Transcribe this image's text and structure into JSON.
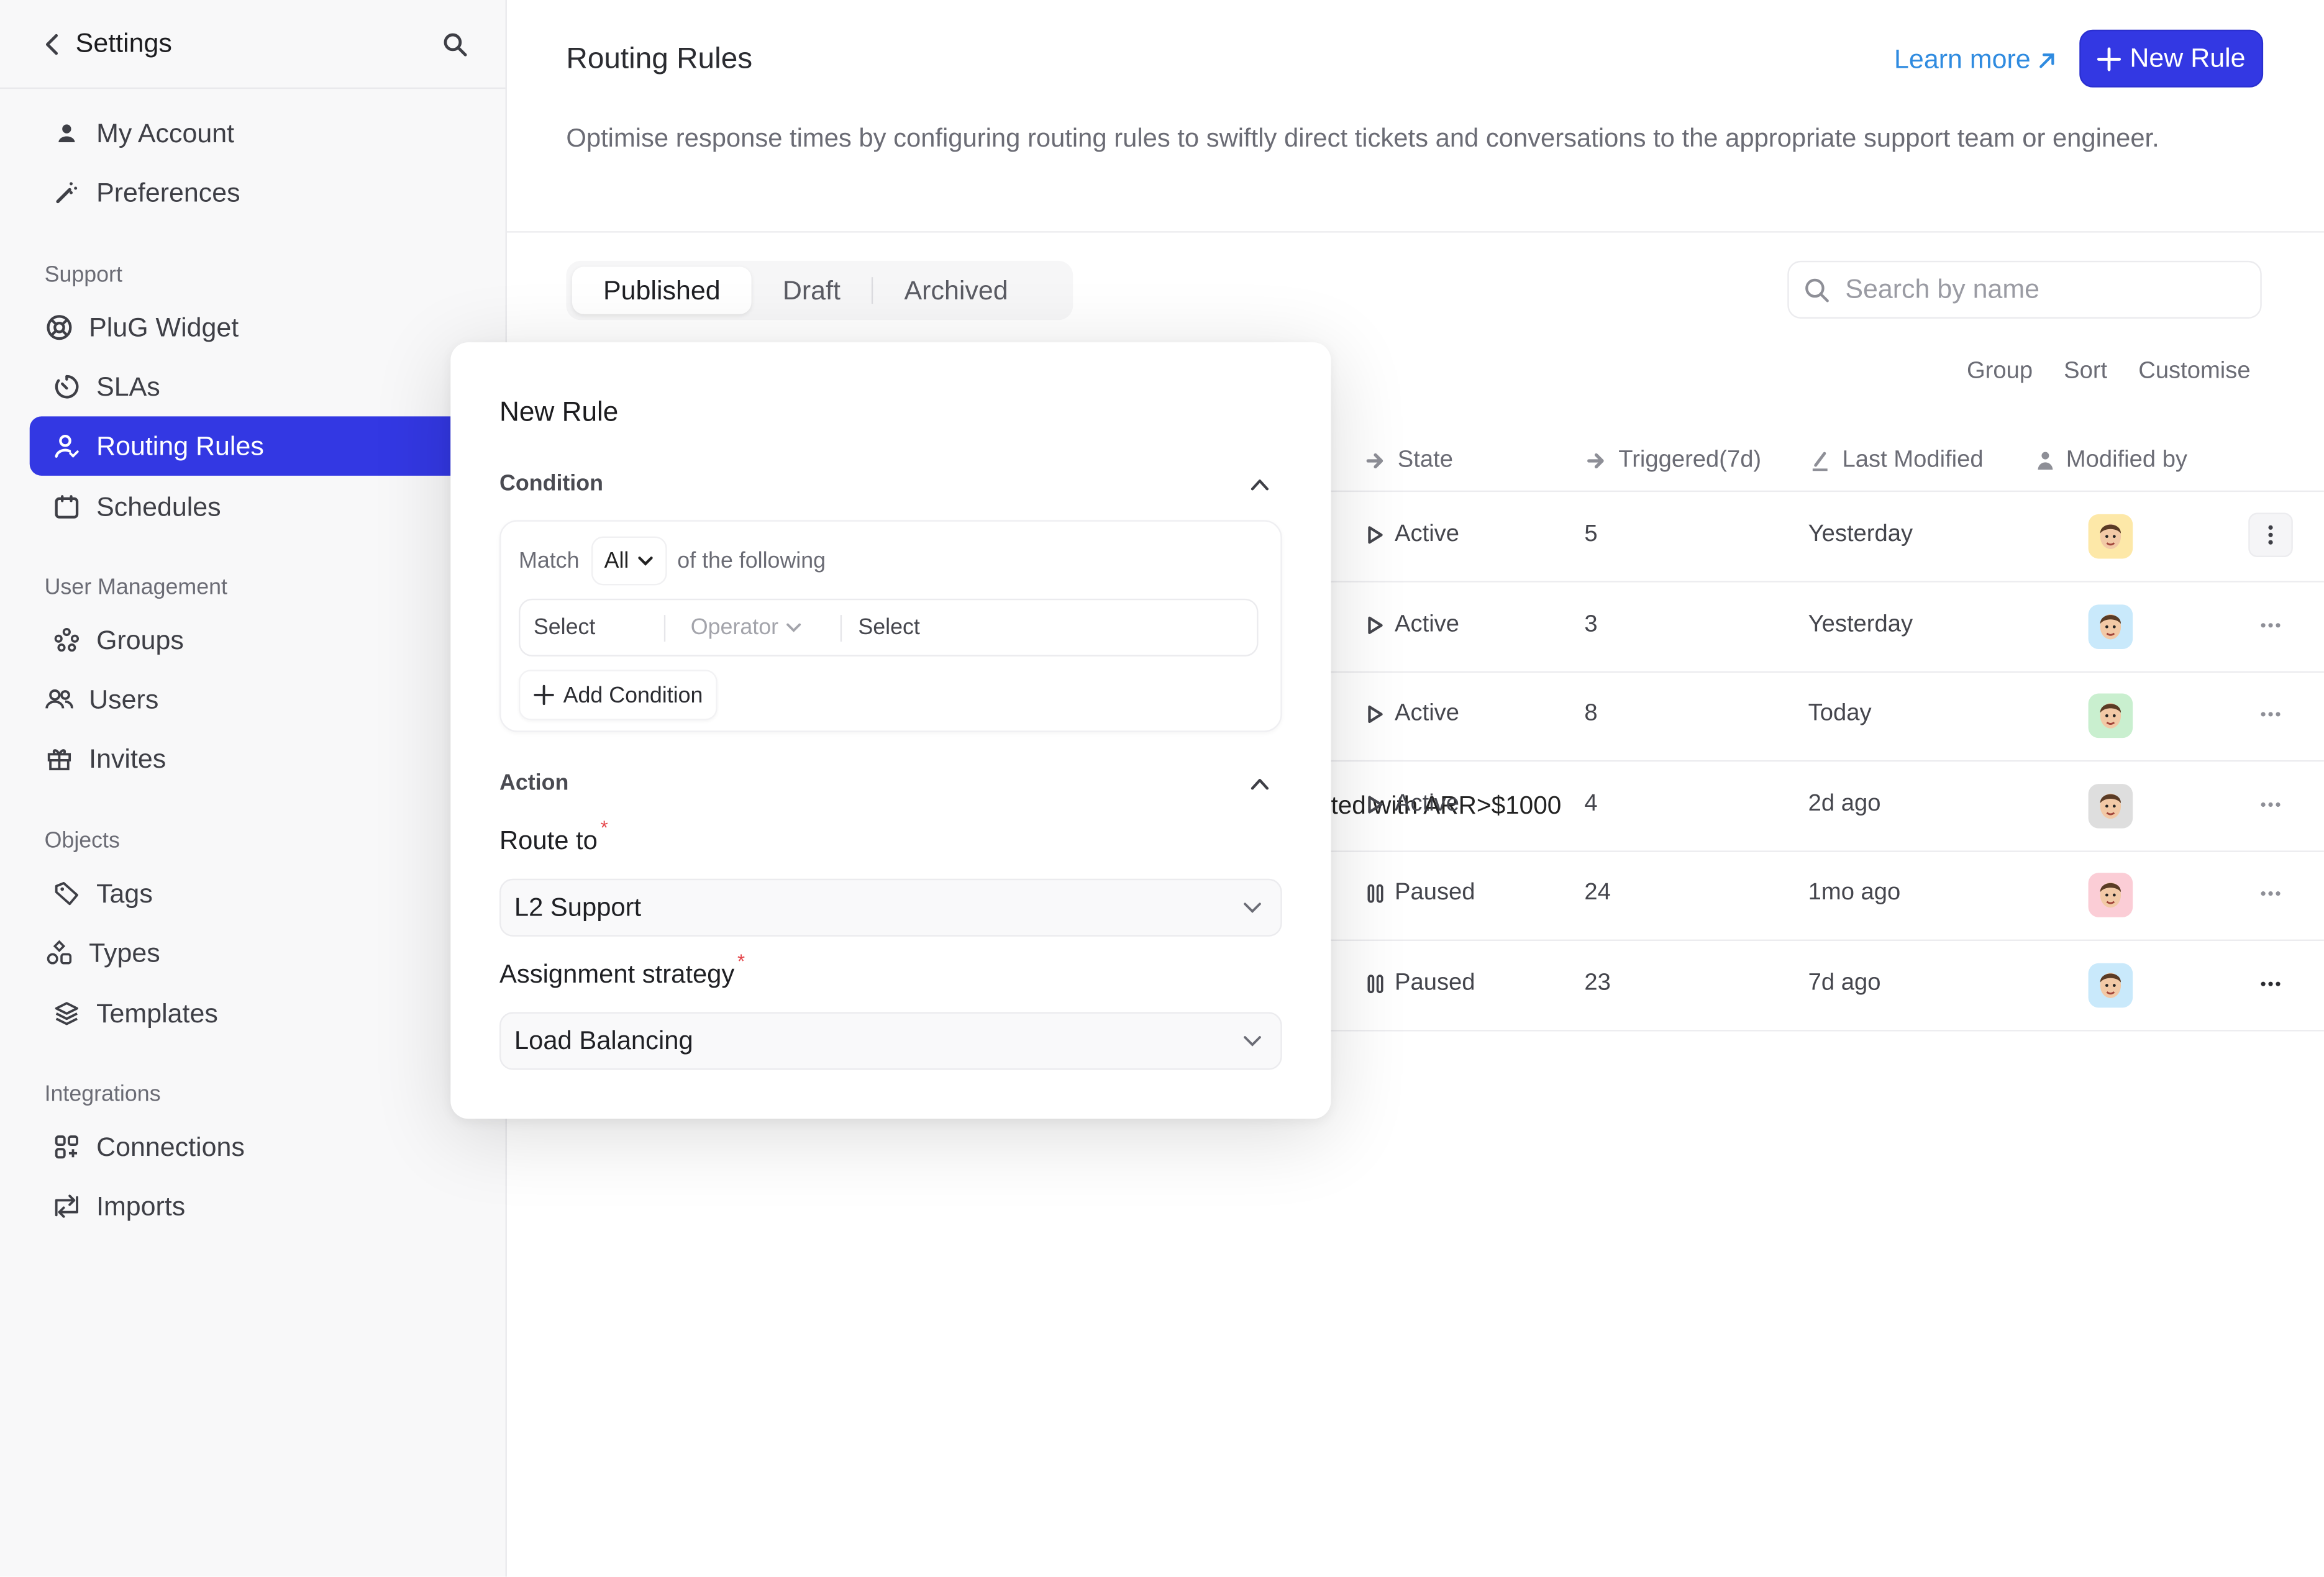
{
  "sidebar": {
    "title": "Settings",
    "top_items": [
      {
        "label": "My Account",
        "icon": "person-icon"
      },
      {
        "label": "Preferences",
        "icon": "magic-wand-icon"
      }
    ],
    "sections": [
      {
        "title": "Support",
        "items": [
          {
            "label": "PluG Widget",
            "icon": "lifebuoy-icon"
          },
          {
            "label": "SLAs",
            "icon": "timer-icon"
          },
          {
            "label": "Routing Rules",
            "icon": "user-check-icon",
            "active": true
          },
          {
            "label": "Schedules",
            "icon": "calendar-icon"
          }
        ]
      },
      {
        "title": "User Management",
        "items": [
          {
            "label": "Groups",
            "icon": "groups-icon"
          },
          {
            "label": "Users",
            "icon": "users-icon"
          },
          {
            "label": "Invites",
            "icon": "gift-icon"
          }
        ]
      },
      {
        "title": "Objects",
        "items": [
          {
            "label": "Tags",
            "icon": "tag-icon"
          },
          {
            "label": "Types",
            "icon": "shapes-icon"
          },
          {
            "label": "Templates",
            "icon": "layers-icon"
          }
        ]
      },
      {
        "title": "Integrations",
        "items": [
          {
            "label": "Connections",
            "icon": "apps-add-icon"
          },
          {
            "label": "Imports",
            "icon": "repeat-icon"
          }
        ]
      }
    ]
  },
  "header": {
    "title": "Routing Rules",
    "learn_more": "Learn more",
    "new_rule": "New Rule",
    "description": "Optimise response times by configuring routing rules to swiftly direct tickets and conversations to the appropriate support team or engineer."
  },
  "tabs": [
    {
      "label": "Published",
      "active": true
    },
    {
      "label": "Draft"
    },
    {
      "label": "Archived"
    }
  ],
  "search": {
    "placeholder": "Search by name",
    "value": ""
  },
  "toolbar": {
    "group": "Group",
    "sort": "Sort",
    "customise": "Customise"
  },
  "table": {
    "columns": {
      "state": "State",
      "triggered": "Triggered(7d)",
      "last_modified": "Last Modified",
      "modified_by": "Modified by"
    },
    "rows": [
      {
        "state": "Active",
        "triggered": "5",
        "last_modified": "Yesterday",
        "avatar_color": "#fde8a8",
        "menu": "vertical"
      },
      {
        "state": "Active",
        "triggered": "3",
        "last_modified": "Yesterday",
        "avatar_color": "#c9e9fb",
        "menu": "horizontal"
      },
      {
        "state": "Active",
        "triggered": "8",
        "last_modified": "Today",
        "avatar_color": "#c9efcf",
        "menu": "horizontal"
      },
      {
        "state": "Active",
        "triggered": "4",
        "last_modified": "2d ago",
        "avatar_color": "#dedede",
        "menu": "horizontal",
        "name_overflow": "ted with ARR>$1000"
      },
      {
        "state": "Paused",
        "triggered": "24",
        "last_modified": "1mo ago",
        "avatar_color": "#fbcdd6",
        "menu": "horizontal"
      },
      {
        "state": "Paused",
        "triggered": "23",
        "last_modified": "7d ago",
        "avatar_color": "#c9e9fb",
        "menu": "horizontal-dark"
      }
    ]
  },
  "modal": {
    "title": "New Rule",
    "condition": {
      "section_label": "Condition",
      "match_label": "Match",
      "match_value": "All",
      "match_tail": "of the following",
      "field_placeholder": "Select",
      "operator_placeholder": "Operator",
      "value_placeholder": "Select",
      "add_condition": "Add Condition"
    },
    "action": {
      "section_label": "Action",
      "route_to_label": "Route to",
      "route_to_value": "L2 Support",
      "strategy_label": "Assignment strategy",
      "strategy_value": "Load Balancing",
      "required_mark": "*"
    }
  },
  "colors": {
    "accent": "#3338e3",
    "link": "#2f8be0",
    "required": "#e5484d"
  }
}
